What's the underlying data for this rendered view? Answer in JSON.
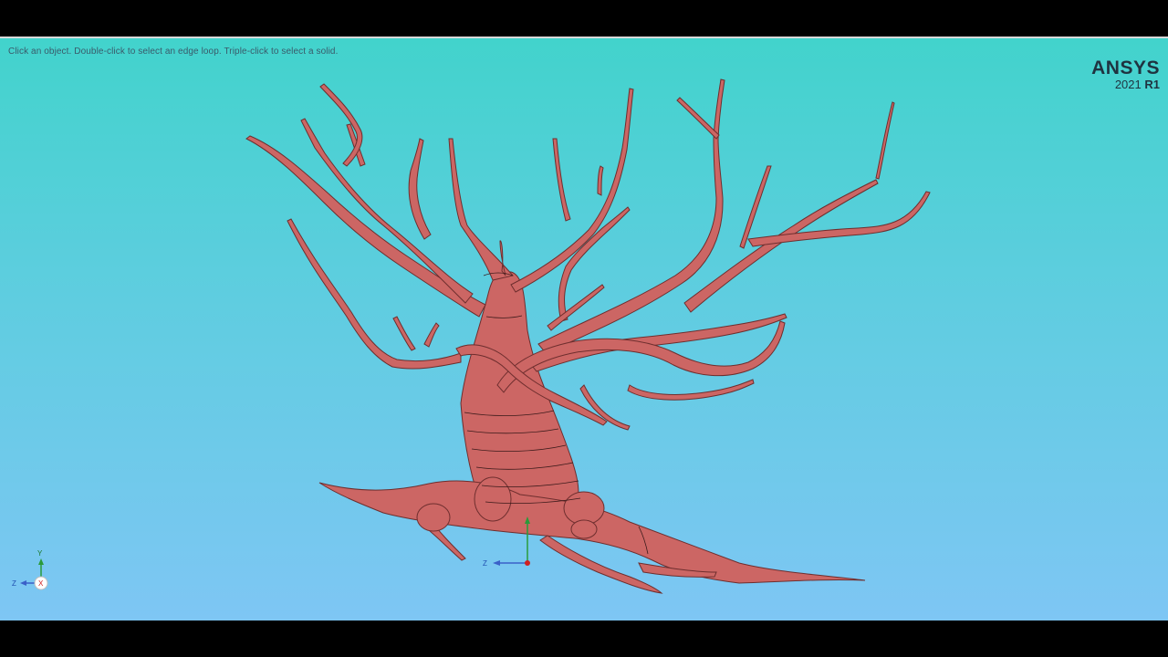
{
  "viewport": {
    "hint": "Click an object. Double-click to select an edge loop. Triple-click to select a solid."
  },
  "brand": {
    "name": "ANSYS",
    "year": "2021",
    "release": "R1"
  },
  "model": {
    "fill_color": "#cc6664",
    "edge_color": "#3a1a1a"
  },
  "triad": {
    "y_label": "Y",
    "z_label": "Z",
    "x_label": "X"
  },
  "local_axes": {
    "z_label": "Z"
  }
}
